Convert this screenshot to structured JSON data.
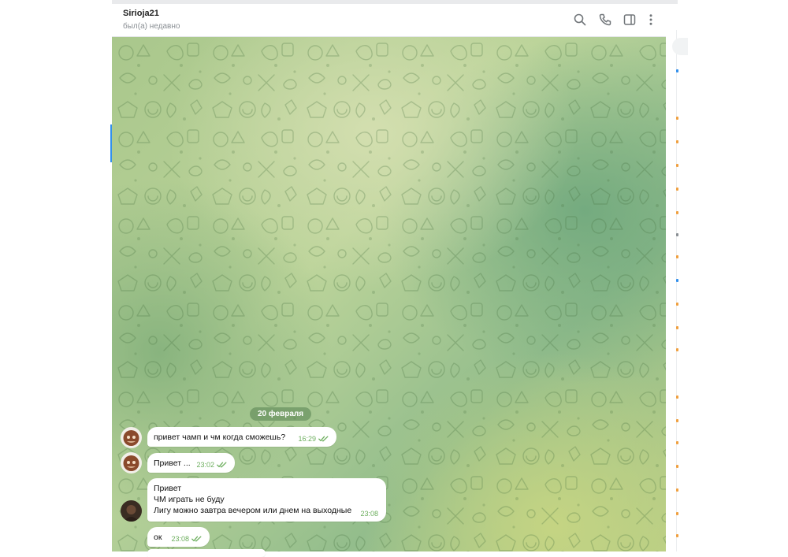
{
  "chat": {
    "name": "Sirioja21",
    "status": "был(а) недавно"
  },
  "header_icons": [
    "search-icon",
    "phone-icon",
    "sidebar-toggle-icon",
    "more-vertical-icon"
  ],
  "date_separator": "20 февраля",
  "messages": [
    {
      "text": "привет чамп и чм когда сможешь?",
      "time": "16:29",
      "read": true,
      "has_avatar": true
    },
    {
      "text": "Привет ...",
      "time": "23:02",
      "read": true,
      "has_avatar": true
    },
    {
      "lines": [
        "Привет",
        "ЧМ играть не буду",
        "Лигу можно завтра вечером или днем на выходные"
      ],
      "time": "23:08",
      "read": false,
      "has_avatar": true
    },
    {
      "text": "ок",
      "time": "23:08",
      "read": true,
      "has_avatar": false
    }
  ],
  "colors": {
    "accent": "#3390ec",
    "checkmark": "#6cae5d",
    "wallpaper": "#a9c78c",
    "right_panel_dots": "#f0a040"
  }
}
